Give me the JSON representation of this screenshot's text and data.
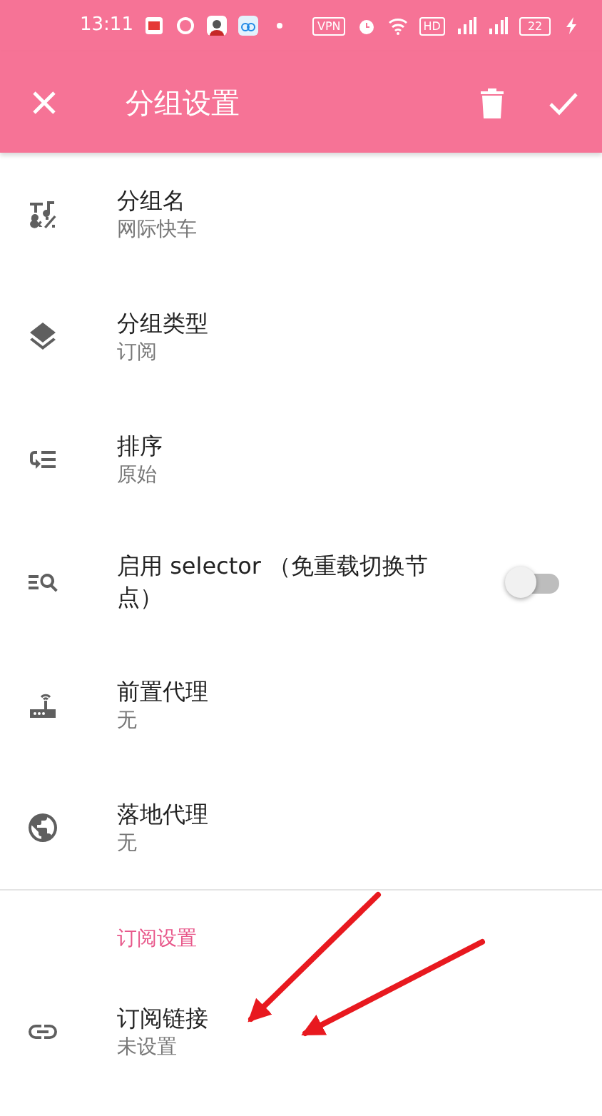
{
  "status_bar": {
    "time": "13:11",
    "vpn": "VPN",
    "hd": "HD",
    "battery": "22"
  },
  "app_bar": {
    "title": "分组设置"
  },
  "items": [
    {
      "kind": "text",
      "title": "分组名",
      "value": "网际快车"
    },
    {
      "kind": "text",
      "title": "分组类型",
      "value": "订阅"
    },
    {
      "kind": "text",
      "title": "排序",
      "value": "原始"
    },
    {
      "kind": "switch",
      "title": "启用 selector （免重载切换节点）",
      "checked": false
    },
    {
      "kind": "text",
      "title": "前置代理",
      "value": "无"
    },
    {
      "kind": "text",
      "title": "落地代理",
      "value": "无"
    }
  ],
  "section": {
    "header": "订阅设置",
    "items": [
      {
        "kind": "text",
        "title": "订阅链接",
        "value": "未设置"
      }
    ]
  }
}
